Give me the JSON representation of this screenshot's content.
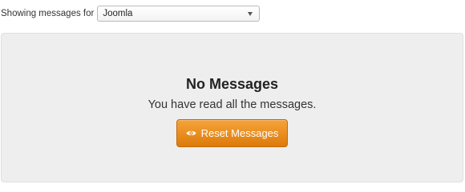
{
  "filter": {
    "label": "Showing messages for",
    "selected": "Joomla"
  },
  "empty_state": {
    "title": "No Messages",
    "message": "You have read all the messages.",
    "reset_button_label": "Reset Messages",
    "reset_button_icon": "eye-icon"
  },
  "colors": {
    "button_top": "#f5a43a",
    "button_bottom": "#dd7a0a",
    "panel_bg": "#eeeeee"
  }
}
